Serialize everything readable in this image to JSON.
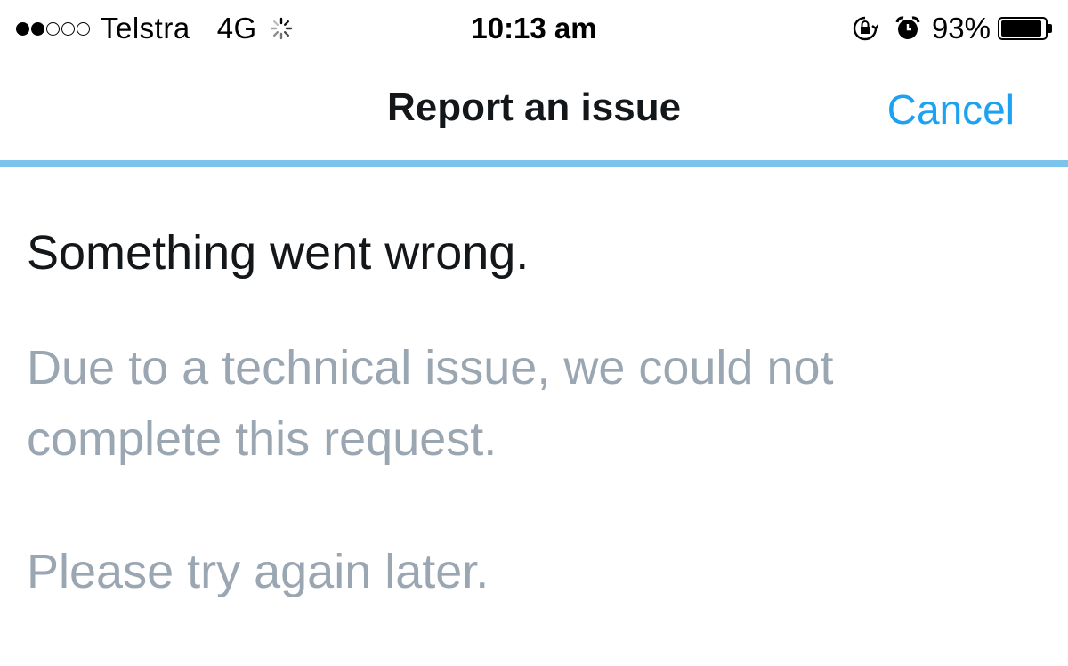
{
  "status_bar": {
    "signal_strength": "2 of 5",
    "carrier": "Telstra",
    "network": "4G",
    "activity_icon": "loading-spinner-icon",
    "time": "10:13 am",
    "rotation_lock_icon": "rotation-lock-icon",
    "alarm_icon": "alarm-clock-icon",
    "battery_percent": "93%",
    "battery_level": 0.93
  },
  "nav": {
    "title": "Report an issue",
    "cancel_label": "Cancel"
  },
  "colors": {
    "accent": "#1da1f2",
    "divider": "#7cc3ec",
    "secondary_text": "#9aa6b1"
  },
  "error": {
    "title": "Something went wrong.",
    "message": "Due to a technical issue, we could not complete this request.",
    "retry": "Please try again later."
  }
}
